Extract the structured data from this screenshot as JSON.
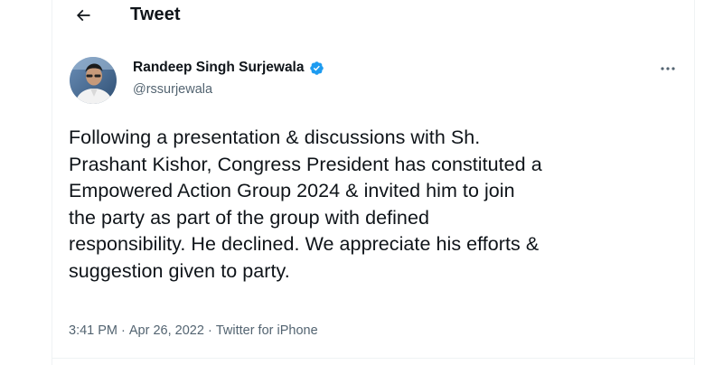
{
  "header": {
    "title": "Tweet",
    "back_icon": "arrow-left-icon"
  },
  "author": {
    "display_name": "Randeep Singh Surjewala",
    "handle": "@rssurjewala",
    "verified": true,
    "verified_icon": "verified-badge-icon",
    "avatar_icon": "profile-photo"
  },
  "more_icon": "more-horizontal-icon",
  "tweet": {
    "text": "Following a presentation & discussions with Sh.\nPrashant Kishor, Congress President has constituted a\nEmpowered Action Group 2024 & invited him to join\nthe party as part of the group with defined\nresponsibility. He declined. We appreciate his efforts &\nsuggestion given to party.",
    "time": "3:41 PM",
    "date": "Apr 26, 2022",
    "source": "Twitter for iPhone",
    "separator": " · "
  },
  "colors": {
    "text_primary": "#0f1419",
    "text_secondary": "#536471",
    "verified_blue": "#1d9bf0",
    "border": "#eff3f4"
  }
}
